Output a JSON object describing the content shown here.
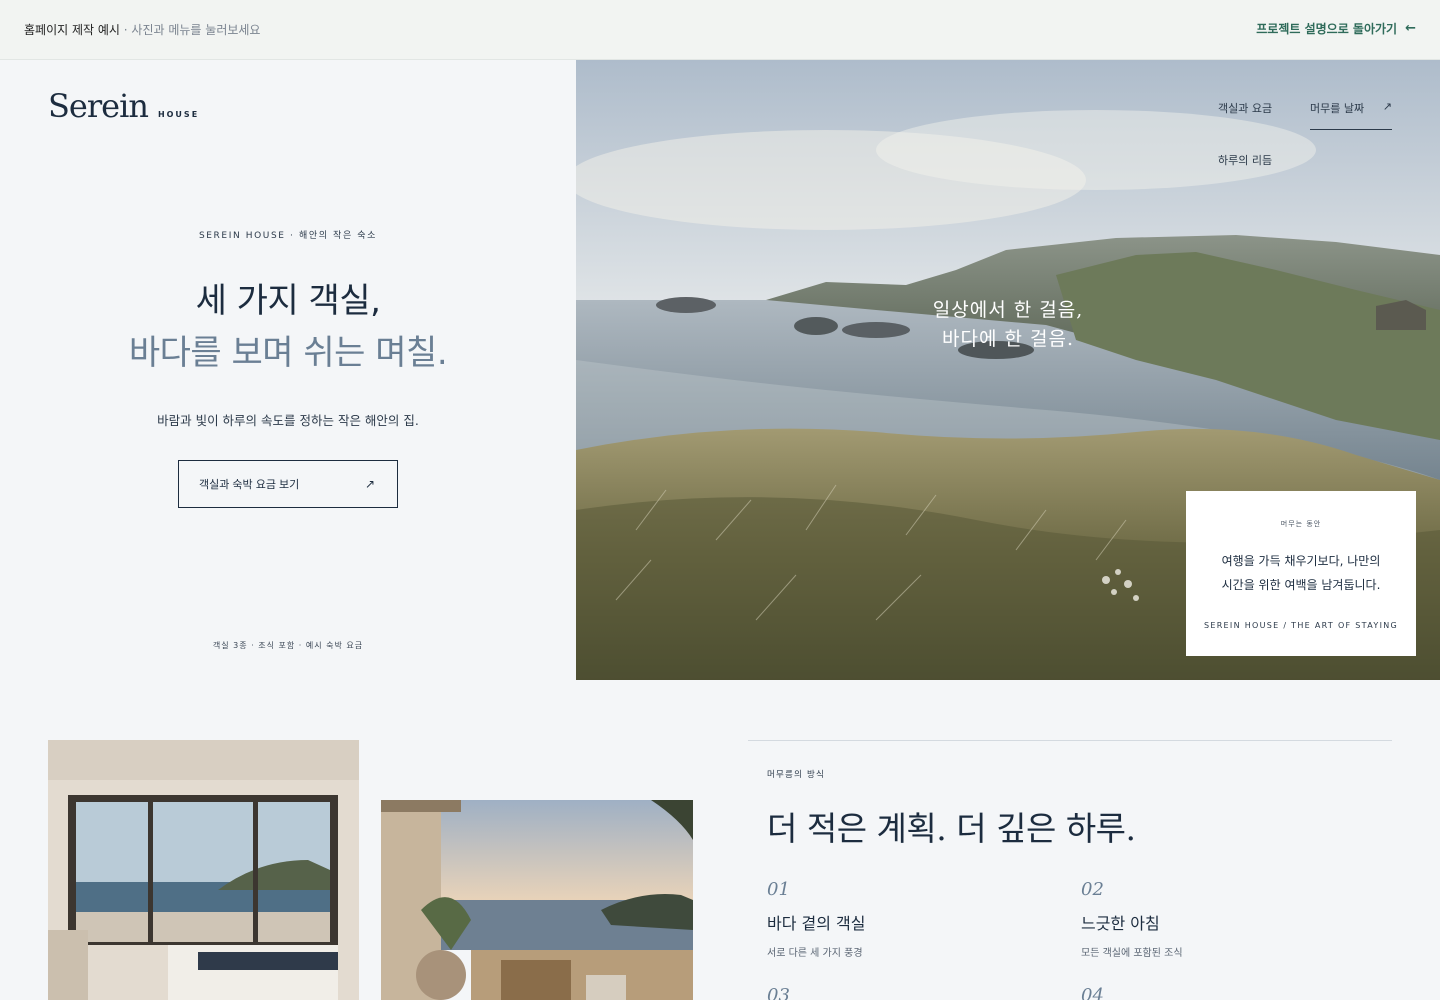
{
  "topbar": {
    "title": "홈페이지 제작 예시",
    "separator": " · ",
    "hint": "사진과 메뉴를 눌러보세요",
    "back_link": "프로젝트 설명으로 돌아가기",
    "back_icon": "arrow-left-icon"
  },
  "brand": {
    "name": "Serein",
    "sub": "HOUSE"
  },
  "hero": {
    "eyebrow": "SEREIN HOUSE · 해안의 작은 숙소",
    "headline_line1": "세 가지 객실,",
    "headline_line2": "바다를 보며 쉬는 며칠.",
    "subcopy": "바람과 빛이 하루의 속도를 정하는 작은 해안의 집.",
    "cta_label": "객실과 숙박 요금 보기",
    "cta_icon": "arrow-up-right-icon",
    "footnote": "객실 3종 · 조식 포함 · 예시 숙박 요금"
  },
  "nav": {
    "items": [
      {
        "label": "객실과 요금"
      },
      {
        "label": "머무를 날짜",
        "icon": "arrow-up-right-icon"
      },
      {
        "label": "하루의 리듬"
      }
    ]
  },
  "image_overlay": {
    "line1": "일상에서 한 걸음,",
    "line2": "바다에 한 걸음."
  },
  "card": {
    "eyebrow": "머무는 동안",
    "body_line1": "여행을 가득 채우기보다, 나만의",
    "body_line2": "시간을 위한 여백을 남겨둡니다.",
    "signature": "SEREIN HOUSE / THE ART OF STAYING"
  },
  "section": {
    "eyebrow": "머무름의 방식",
    "title": "더 적은 계획. 더 깊은 하루.",
    "features": [
      {
        "num": "01",
        "title": "바다 곁의 객실",
        "desc": "서로 다른 세 가지 풍경"
      },
      {
        "num": "02",
        "title": "느긋한 아침",
        "desc": "모든 객실에 포함된 조식"
      },
      {
        "num": "03",
        "title": "",
        "desc": ""
      },
      {
        "num": "04",
        "title": "",
        "desc": ""
      }
    ]
  },
  "colors": {
    "navy": "#1c2c3f",
    "slate": "#6a7f94",
    "accent_green": "#2f6b5a",
    "background": "#f4f6f8"
  }
}
